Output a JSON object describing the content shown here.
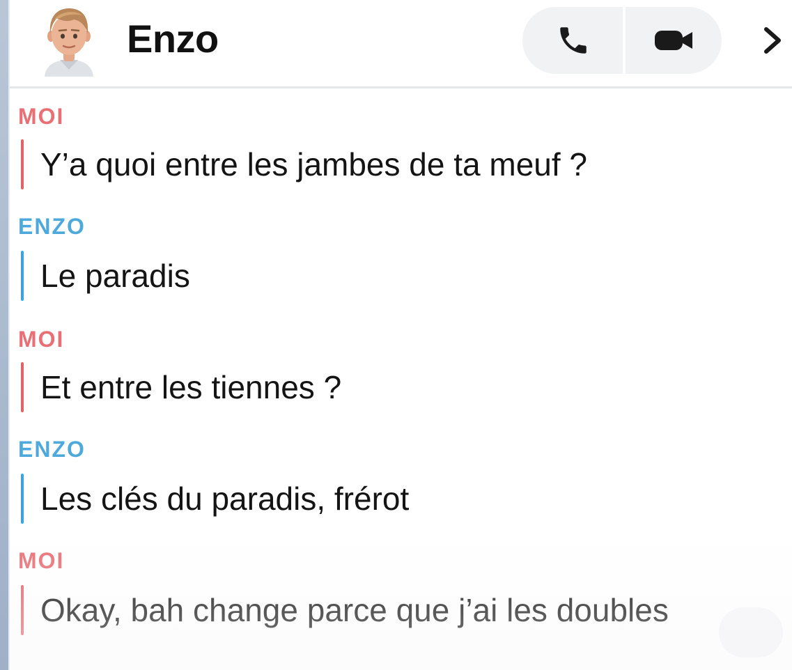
{
  "header": {
    "contact_name": "Enzo",
    "avatar_icon": "bitmoji-avatar",
    "call_icon": "phone-icon",
    "video_icon": "video-camera-icon",
    "more_icon": "chevron-right-icon"
  },
  "messages": [
    {
      "sender": "MOI",
      "sender_type": "me",
      "text": "Y’a quoi entre les jambes de ta meuf ?"
    },
    {
      "sender": "ENZO",
      "sender_type": "enzo",
      "text": "Le paradis"
    },
    {
      "sender": "MOI",
      "sender_type": "me",
      "text": "Et entre les tiennes ?"
    },
    {
      "sender": "ENZO",
      "sender_type": "enzo",
      "text": "Les clés du paradis, frérot"
    },
    {
      "sender": "MOI",
      "sender_type": "me",
      "text": "Okay, bah change parce que j’ai les doubles"
    }
  ],
  "colors": {
    "me": "#e3474f",
    "enzo": "#2e9bd6"
  }
}
